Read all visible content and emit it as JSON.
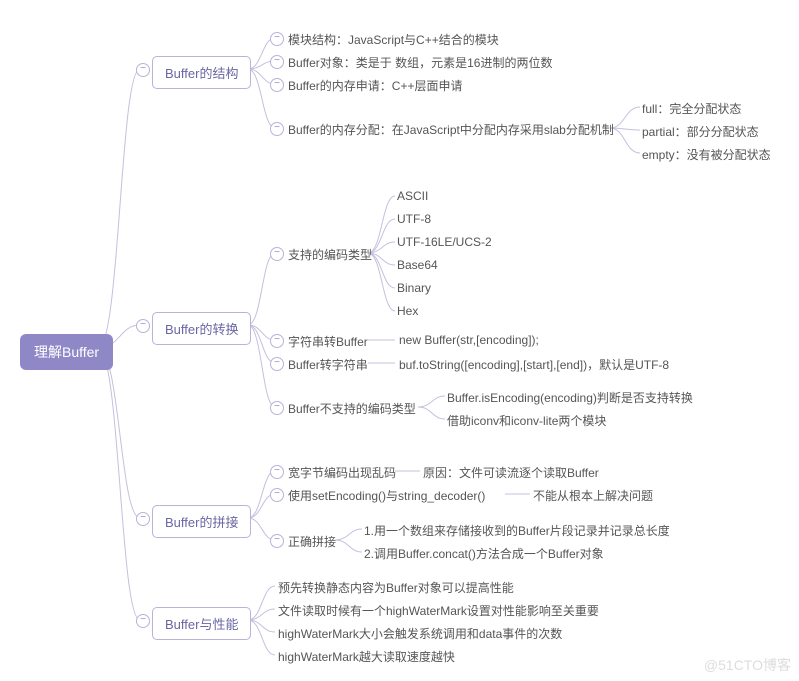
{
  "root": "理解Buffer",
  "l1": [
    "Buffer的结构",
    "Buffer的转换",
    "Buffer的拼接",
    "Buffer与性能"
  ],
  "struct": [
    "模块结构：JavaScript与C++结合的模块",
    "Buffer对象：类是于 数组，元素是16进制的两位数",
    "Buffer的内存申请：C++层面申请",
    "Buffer的内存分配：在JavaScript中分配内存采用slab分配机制"
  ],
  "slab": [
    "full：完全分配状态",
    "partial：部分分配状态",
    "empty：没有被分配状态"
  ],
  "conv": {
    "0": "支持的编码类型",
    "1": "字符串转Buffer",
    "1b": "new Buffer(str,[encoding]);",
    "2": "Buffer转字符串",
    "2b": "buf.toString([encoding],[start],[end])，默认是UTF-8",
    "3": "Buffer不支持的编码类型"
  },
  "enc": [
    "ASCII",
    "UTF-8",
    "UTF-16LE/UCS-2",
    "Base64",
    "Binary",
    "Hex"
  ],
  "unsup": [
    "Buffer.isEncoding(encoding)判断是否支持转换",
    "借助iconv和iconv-lite两个模块"
  ],
  "concat": {
    "0": "宽字节编码出现乱码",
    "0b": "原因：文件可读流逐个读取Buffer",
    "1": "使用setEncoding()与string_decoder()",
    "1b": "不能从根本上解决问题",
    "2": "正确拼接"
  },
  "correct": [
    "1.用一个数组来存储接收到的Buffer片段记录并记录总长度",
    "2.调用Buffer.concat()方法合成一个Buffer对象"
  ],
  "perf": [
    "预先转换静态内容为Buffer对象可以提高性能",
    "文件读取时候有一个highWaterMark设置对性能影响至关重要",
    "highWaterMark大小会触发系统调用和data事件的次数",
    "highWaterMark越大读取速度越快"
  ],
  "watermark": "@51CTO博客"
}
